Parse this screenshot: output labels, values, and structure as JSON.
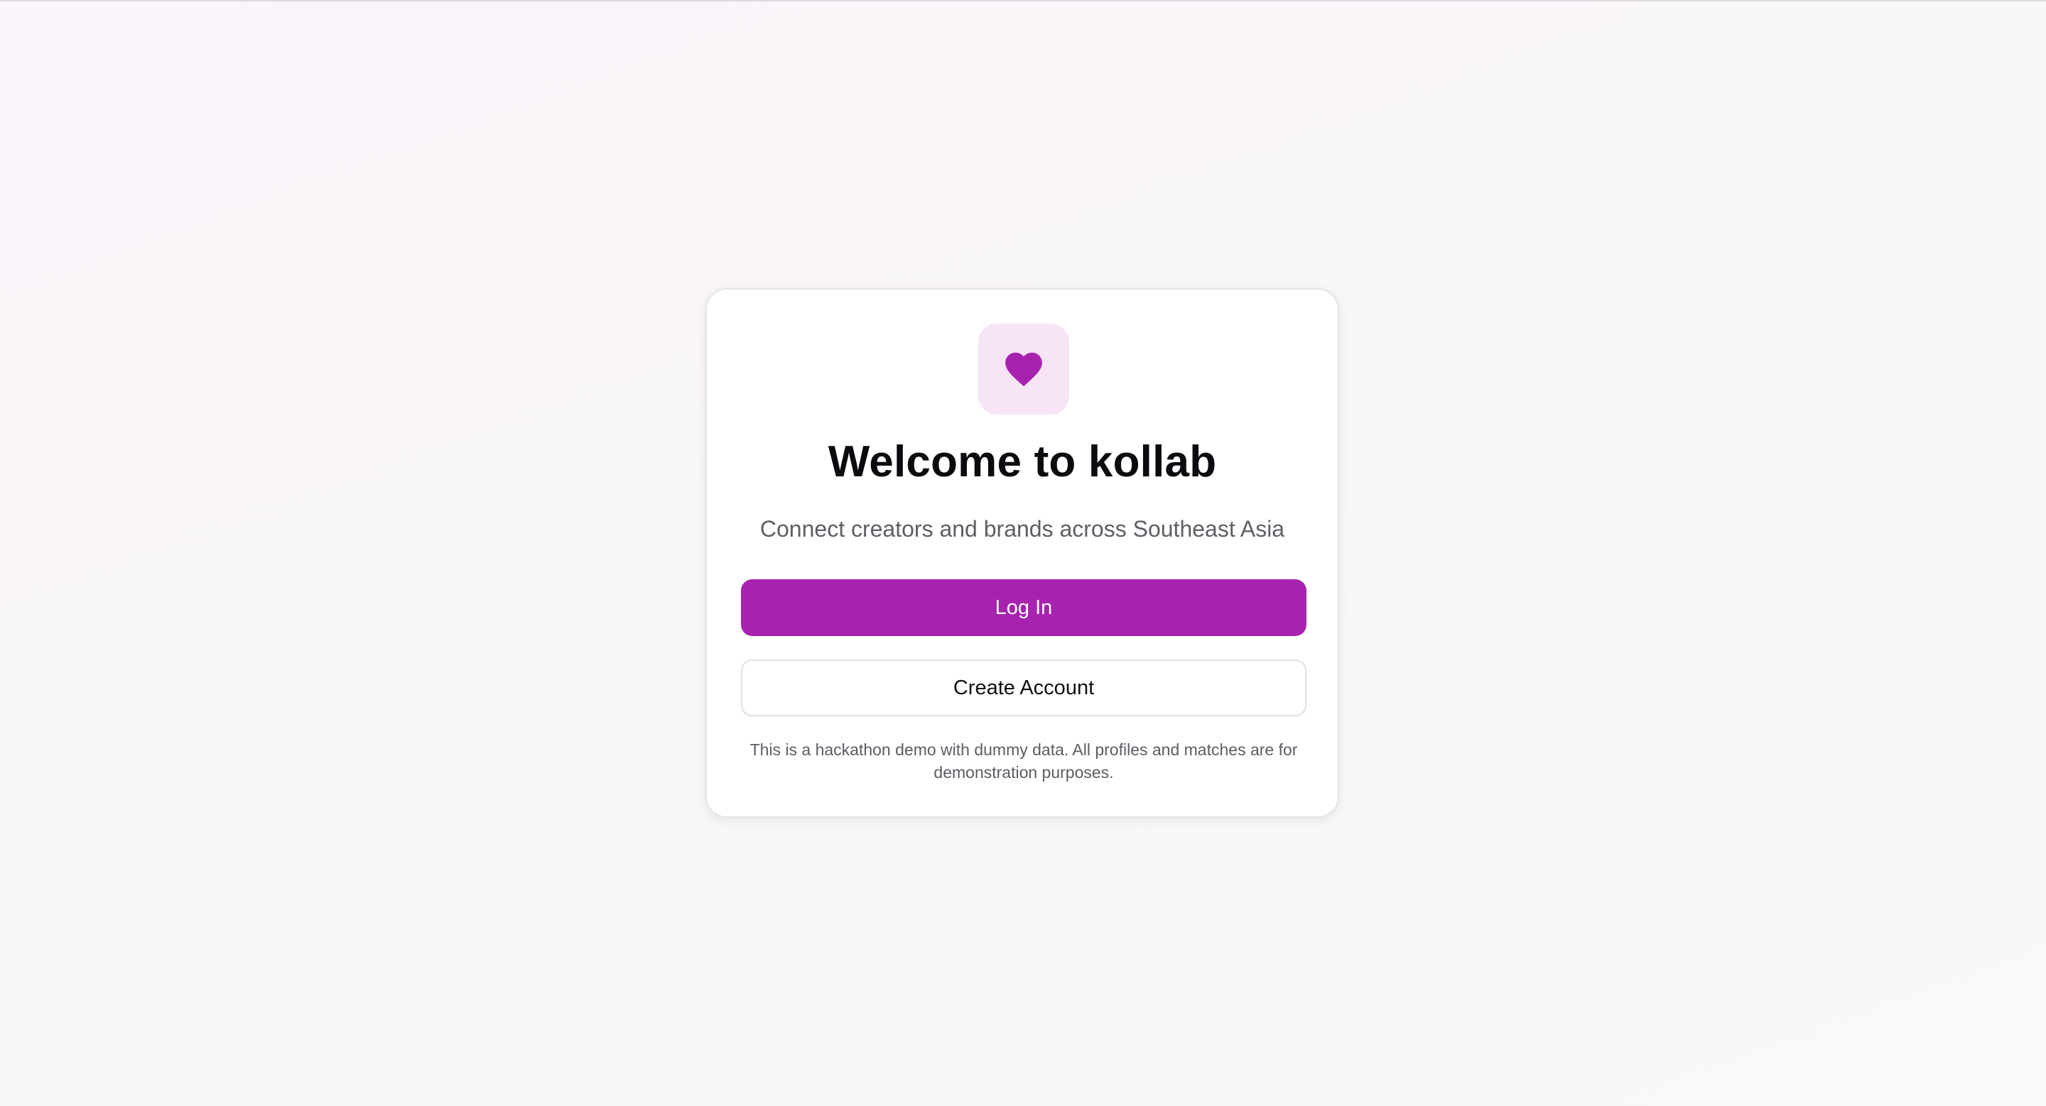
{
  "app": {
    "title": "Welcome to kollab",
    "subtitle": "Connect creators and brands across Southeast Asia",
    "logo_icon": "heart-icon",
    "accent_color": "#a722ae",
    "logo_tile_color": "#f7e4f5"
  },
  "actions": {
    "login_label": "Log In",
    "create_account_label": "Create Account"
  },
  "footer": {
    "disclaimer": "This is a hackathon demo with dummy data. All profiles and matches are for demonstration purposes."
  }
}
